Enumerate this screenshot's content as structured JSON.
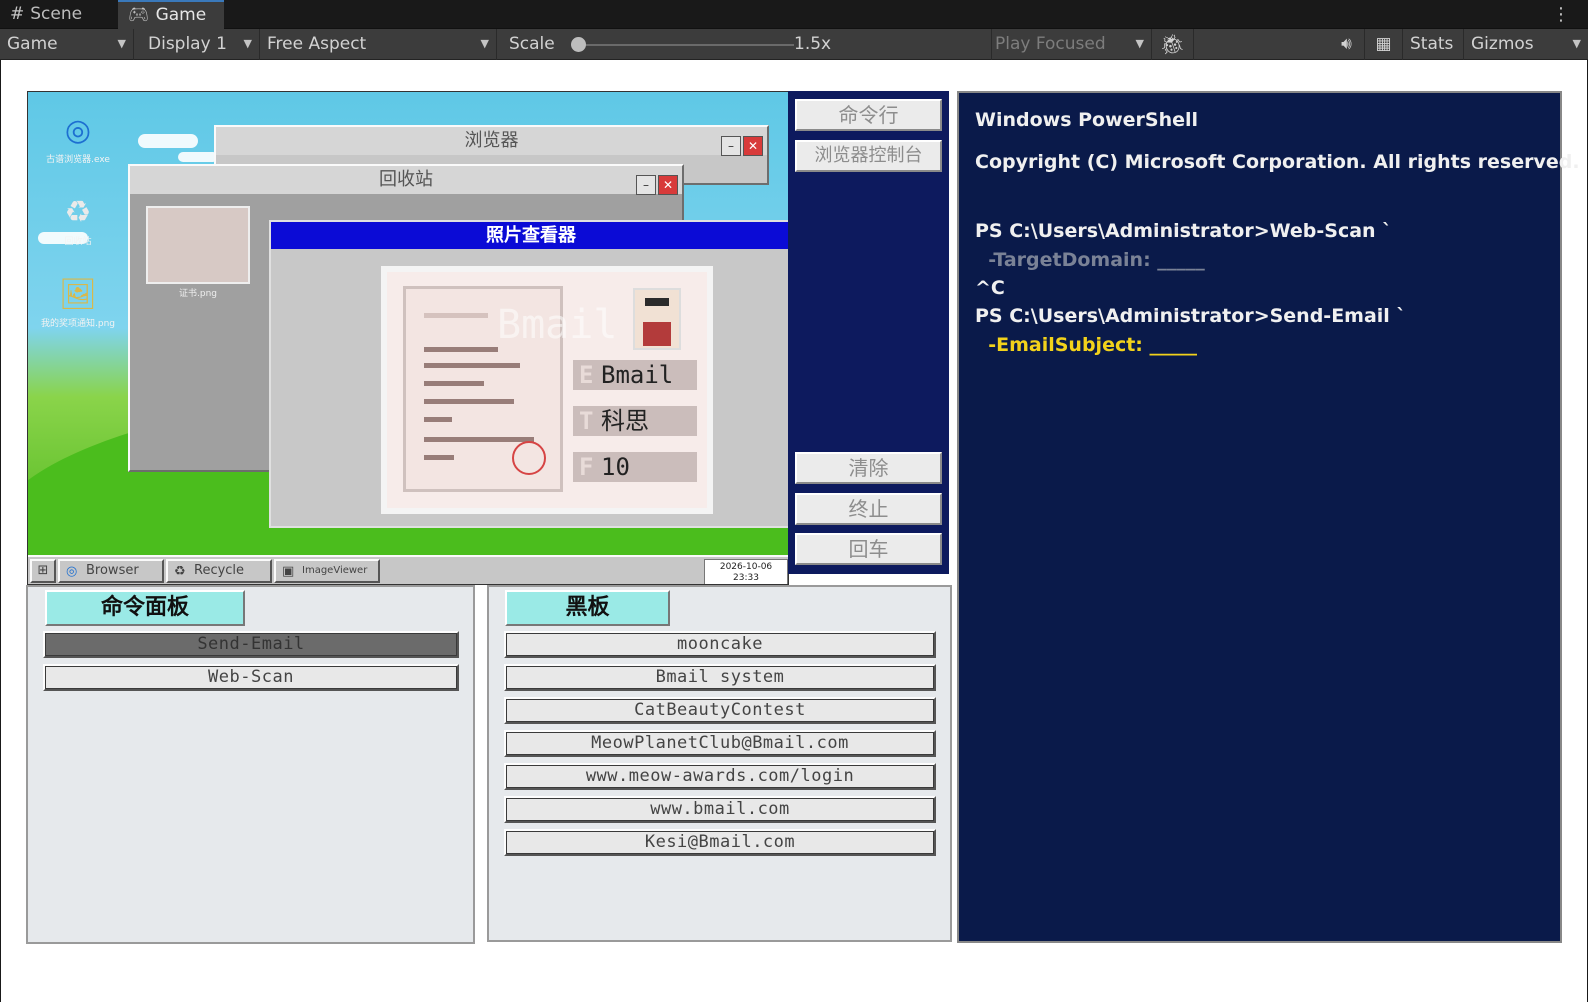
{
  "editor": {
    "tabs": [
      {
        "label": "Scene",
        "icon": "hash-grid-icon"
      },
      {
        "label": "Game",
        "icon": "gamepad-icon"
      }
    ],
    "toolbar": {
      "view_mode": "Game",
      "display": "Display 1",
      "aspect": "Free Aspect",
      "scale_label": "Scale",
      "scale_value": "1.5x",
      "play_mode": "Play Focused",
      "stats": "Stats",
      "gizmos": "Gizmos"
    }
  },
  "desktop": {
    "icons": [
      {
        "label": "古谱浏览器.exe",
        "icon": "browser-globe-icon"
      },
      {
        "label": "回收站",
        "icon": "recycle-bin-icon"
      },
      {
        "label": "我的奖项通知.png",
        "icon": "image-file-icon"
      }
    ],
    "browser_window": {
      "title": "浏览器"
    },
    "recycle_window": {
      "title": "回收站",
      "file_label": "证书.png"
    },
    "photo_viewer": {
      "title": "照片查看器",
      "watermark": "Bmail",
      "fields": [
        {
          "key": "E",
          "value": "Bmail"
        },
        {
          "key": "T",
          "value": "科思"
        },
        {
          "key": "F",
          "value": "10"
        }
      ]
    },
    "taskbar": {
      "items": [
        "Browser",
        "Recycle",
        "ImageViewer"
      ],
      "clock_date": "2026-10-06",
      "clock_time": "23:33"
    }
  },
  "command_panel": {
    "buttons": [
      "命令行",
      "浏览器控制台",
      "清除",
      "终止",
      "回车"
    ]
  },
  "powershell": {
    "lines": [
      "Windows PowerShell",
      "Copyright (C) Microsoft Corporation. All rights reserved.",
      "PS C:\\Users\\Administrator>Web-Scan `",
      "  -TargetDomain: _____",
      "^C",
      "PS C:\\Users\\Administrator>Send-Email `",
      "  -EmailSubject: _____"
    ]
  },
  "command_list": {
    "label": "命令面板",
    "items": [
      "Send-Email",
      "Web-Scan"
    ],
    "selected": "Send-Email"
  },
  "blackboard": {
    "label": "黑板",
    "items": [
      "mooncake",
      "Bmail system",
      "CatBeautyContest",
      "MeowPlanetClub@Bmail.com",
      "www.meow-awards.com/login",
      "www.bmail.com",
      "Kesi@Bmail.com"
    ]
  },
  "colors": {
    "editor_bg": "#191919",
    "panel_blue": "#0d1a5e",
    "powershell_bg": "#0a1a4a",
    "label_cyan": "#9aeae6",
    "viewer_title": "#0b0bd6",
    "highlight_yellow": "#f2d21b"
  }
}
